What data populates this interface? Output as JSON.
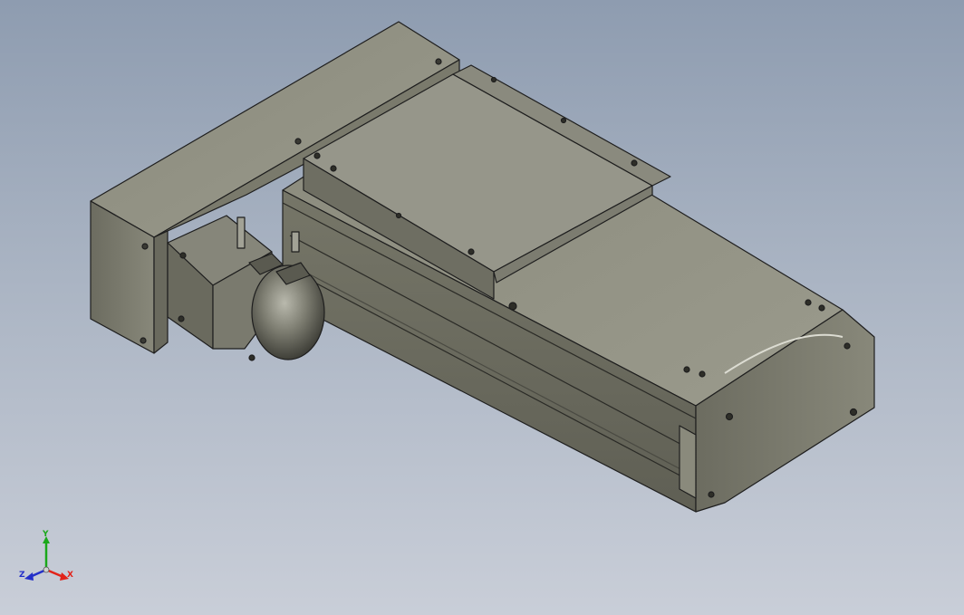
{
  "viewport": {
    "background_top": "#8e9cb0",
    "background_bottom": "#c9ced8",
    "model_color": "#7c7c6e",
    "edge_color": "#1e1e1e"
  },
  "triad": {
    "x_label": "X",
    "y_label": "Y",
    "z_label": "Z",
    "x_color": "#e2231a",
    "y_color": "#1aa81a",
    "z_color": "#2430c9"
  }
}
